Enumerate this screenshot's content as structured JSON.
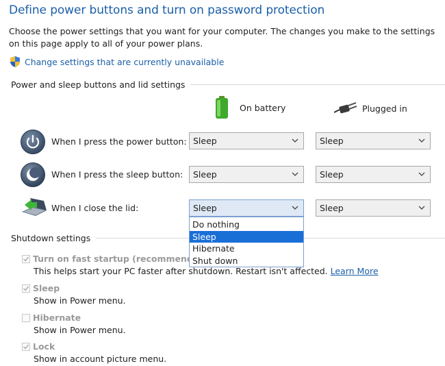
{
  "page_title": "Define power buttons and turn on password protection",
  "description": "Choose the power settings that you want for your computer. The changes you make to the settings on this page apply to all of your power plans.",
  "change_settings_link": "Change settings that are currently unavailable",
  "buttons_section": {
    "title": "Power and sleep buttons and lid settings",
    "col_battery": "On battery",
    "col_plugged": "Plugged in",
    "rows": [
      {
        "label": "When I press the power button:",
        "battery": "Sleep",
        "plugged": "Sleep",
        "icon": "power-icon"
      },
      {
        "label": "When I press the sleep button:",
        "battery": "Sleep",
        "plugged": "Sleep",
        "icon": "sleep-icon"
      },
      {
        "label": "When I close the lid:",
        "battery": "Sleep",
        "plugged": "Sleep",
        "icon": "laptop-lid-icon"
      }
    ]
  },
  "lid_dropdown": {
    "options": [
      "Do nothing",
      "Sleep",
      "Hibernate",
      "Shut down"
    ],
    "selected": "Sleep"
  },
  "shutdown_section": {
    "title": "Shutdown settings",
    "items": [
      {
        "label": "Turn on fast startup (recommended)",
        "checked": true,
        "desc": "This helps start your PC faster after shutdown. Restart isn't affected.",
        "link": "Learn More"
      },
      {
        "label": "Sleep",
        "checked": true,
        "desc": "Show in Power menu."
      },
      {
        "label": "Hibernate",
        "checked": false,
        "desc": "Show in Power menu."
      },
      {
        "label": "Lock",
        "checked": true,
        "desc": "Show in account picture menu."
      }
    ]
  },
  "colors": {
    "title_blue": "#1a5fa8",
    "selection_blue": "#1a6fd6"
  }
}
